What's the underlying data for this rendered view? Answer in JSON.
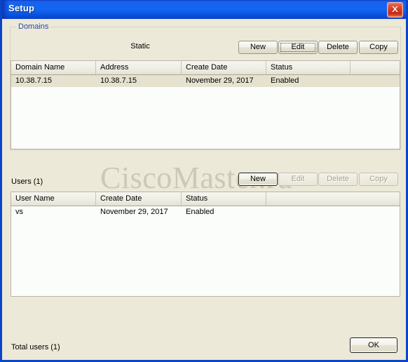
{
  "window": {
    "title": "Setup",
    "close_icon": "close-icon",
    "accent_titlebar": "#1463f0",
    "close_button_color": "#d9412a",
    "dialog_background": "#ece9d8"
  },
  "domains_group": {
    "legend": "Domains",
    "legend_color": "#2a47a8",
    "static_label": "Static",
    "buttons": [
      {
        "label": "New",
        "state": "enabled"
      },
      {
        "label": "Edit",
        "state": "focused"
      },
      {
        "label": "Delete",
        "state": "enabled"
      },
      {
        "label": "Copy",
        "state": "enabled"
      }
    ]
  },
  "domains_table": {
    "columns": [
      "Domain Name",
      "Address",
      "Create Date",
      "Status"
    ],
    "rows": [
      {
        "selected": true,
        "cells": [
          "10.38.7.15",
          "10.38.7.15",
          "November 29, 2017",
          "Enabled"
        ]
      }
    ],
    "selection_color": "#e5e2cf"
  },
  "users_section": {
    "label": "Users (1)",
    "buttons": [
      {
        "label": "New",
        "state": "default"
      },
      {
        "label": "Edit",
        "state": "disabled"
      },
      {
        "label": "Delete",
        "state": "disabled"
      },
      {
        "label": "Copy",
        "state": "disabled"
      }
    ]
  },
  "users_table": {
    "columns": [
      "User Name",
      "Create Date",
      "Status"
    ],
    "rows": [
      {
        "selected": false,
        "cells": [
          "vs",
          "November 29, 2017",
          "Enabled"
        ]
      }
    ]
  },
  "watermark": {
    "text": "CiscoMaster.ru",
    "color": "#b8b5a6"
  },
  "footer": {
    "total_label": "Total users (1)",
    "ok_label": "OK"
  }
}
